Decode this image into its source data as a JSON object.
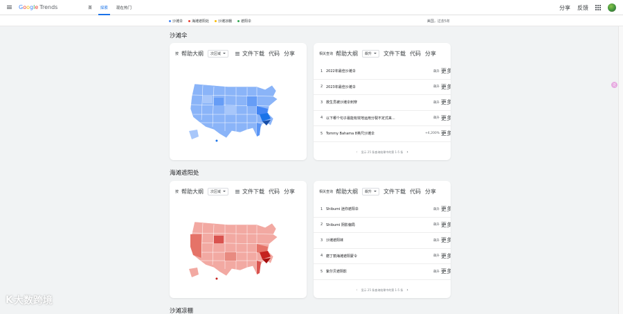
{
  "header": {
    "logo": {
      "g1": "G",
      "g2": "o",
      "g3": "o",
      "g4": "g",
      "g5": "l",
      "g6": "e",
      "trends": "Trends"
    },
    "nav": [
      "首",
      "探索",
      "现在热门"
    ],
    "share": "分享",
    "feedback": "反馈"
  },
  "legend": {
    "items": [
      {
        "label": "沙滩伞",
        "color": "#4285f4"
      },
      {
        "label": "海滩遮阳处",
        "color": "#ea4335"
      },
      {
        "label": "沙滩凉棚",
        "color": "#fbbc05"
      },
      {
        "label": "遮阳伞",
        "color": "#34a853"
      }
    ],
    "meta": "美国，过去5年"
  },
  "sections": [
    {
      "title": "沙滩伞",
      "map_card": {
        "tb_start": "按",
        "help": "帮助大纲",
        "dropdown": "次区域",
        "download": "文件下载",
        "code": "代码",
        "share": "分享"
      },
      "query_card": {
        "label": "相关查询",
        "help": "帮助大纲",
        "dropdown": "飙升",
        "download": "文件下载",
        "code": "代码",
        "share": "分享",
        "rows": [
          {
            "n": "1",
            "text": "2022年最佳沙滩伞",
            "val": "飙升",
            "more": "更多"
          },
          {
            "n": "2",
            "text": "2023年最佳沙滩伞",
            "val": "飙升",
            "more": "更多"
          },
          {
            "n": "3",
            "text": "救生员被沙滩伞刺穿",
            "val": "飙升",
            "more": "更多"
          },
          {
            "n": "4",
            "text": "以下哪个句子最能有效地运用分裂不定式来...",
            "val": "飙升",
            "more": "更多"
          },
          {
            "n": "5",
            "text": "Tommy Bahama 8英尺沙滩伞",
            "val": "+4,200%",
            "more": "更多"
          }
        ],
        "pager": "显示 25 条查询结果中的第 1-5 条"
      }
    },
    {
      "title": "海滩遮阳处",
      "map_card": {
        "tb_start": "按",
        "help": "帮助大纲",
        "dropdown": "次区域",
        "download": "文件下载",
        "code": "代码",
        "share": "分享"
      },
      "query_card": {
        "label": "相关查询",
        "help": "帮助大纲",
        "dropdown": "飙升",
        "download": "文件下载",
        "code": "代码",
        "share": "分享",
        "rows": [
          {
            "n": "1",
            "text": "Shibumi 迷你遮阳伞",
            "val": "飙升",
            "more": "更多"
          },
          {
            "n": "2",
            "text": "Shibumi 阴影偏局",
            "val": "飙升",
            "more": "更多"
          },
          {
            "n": "3",
            "text": "沙滩遮阳袜",
            "val": "飙升",
            "more": "更多"
          },
          {
            "n": "4",
            "text": "磨丁丽海滩遮阳蒙令",
            "val": "飙升",
            "more": "更多"
          },
          {
            "n": "5",
            "text": "紫尔贝遮阴影",
            "val": "飙升",
            "more": "更多"
          }
        ],
        "pager": "显示 25 条查询结果中的第 1-5 条"
      }
    },
    {
      "title": "沙滩凉棚"
    }
  ],
  "float_badge": "泛",
  "watermark": {
    "logo": "K",
    "text": "大数跨境"
  }
}
